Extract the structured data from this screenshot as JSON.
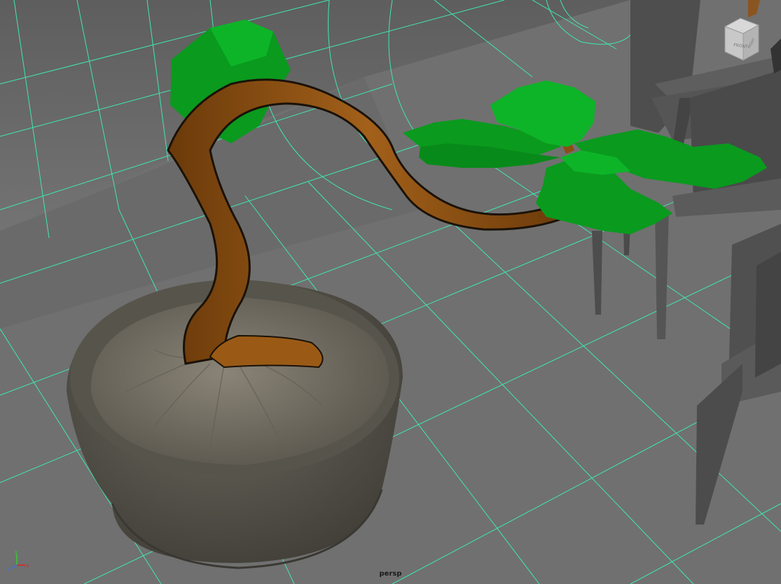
{
  "viewport": {
    "camera_name": "persp",
    "view_cube_face_front": "FRONT",
    "view_cube_face_side": "RIGHT",
    "axis_labels": {
      "x": "x",
      "y": "y",
      "z": "z"
    }
  },
  "colors": {
    "background": "#6f6f6f",
    "grid_line": "#3ee8b0",
    "leaf_green": "#0a9a1e",
    "trunk_brown": "#8a4f12",
    "pot_gray": "#5c5a52",
    "soil": "#7a7468",
    "chair": "#5a5a5a"
  },
  "icons": [
    "view-cube-icon",
    "axis-gizmo-icon"
  ]
}
